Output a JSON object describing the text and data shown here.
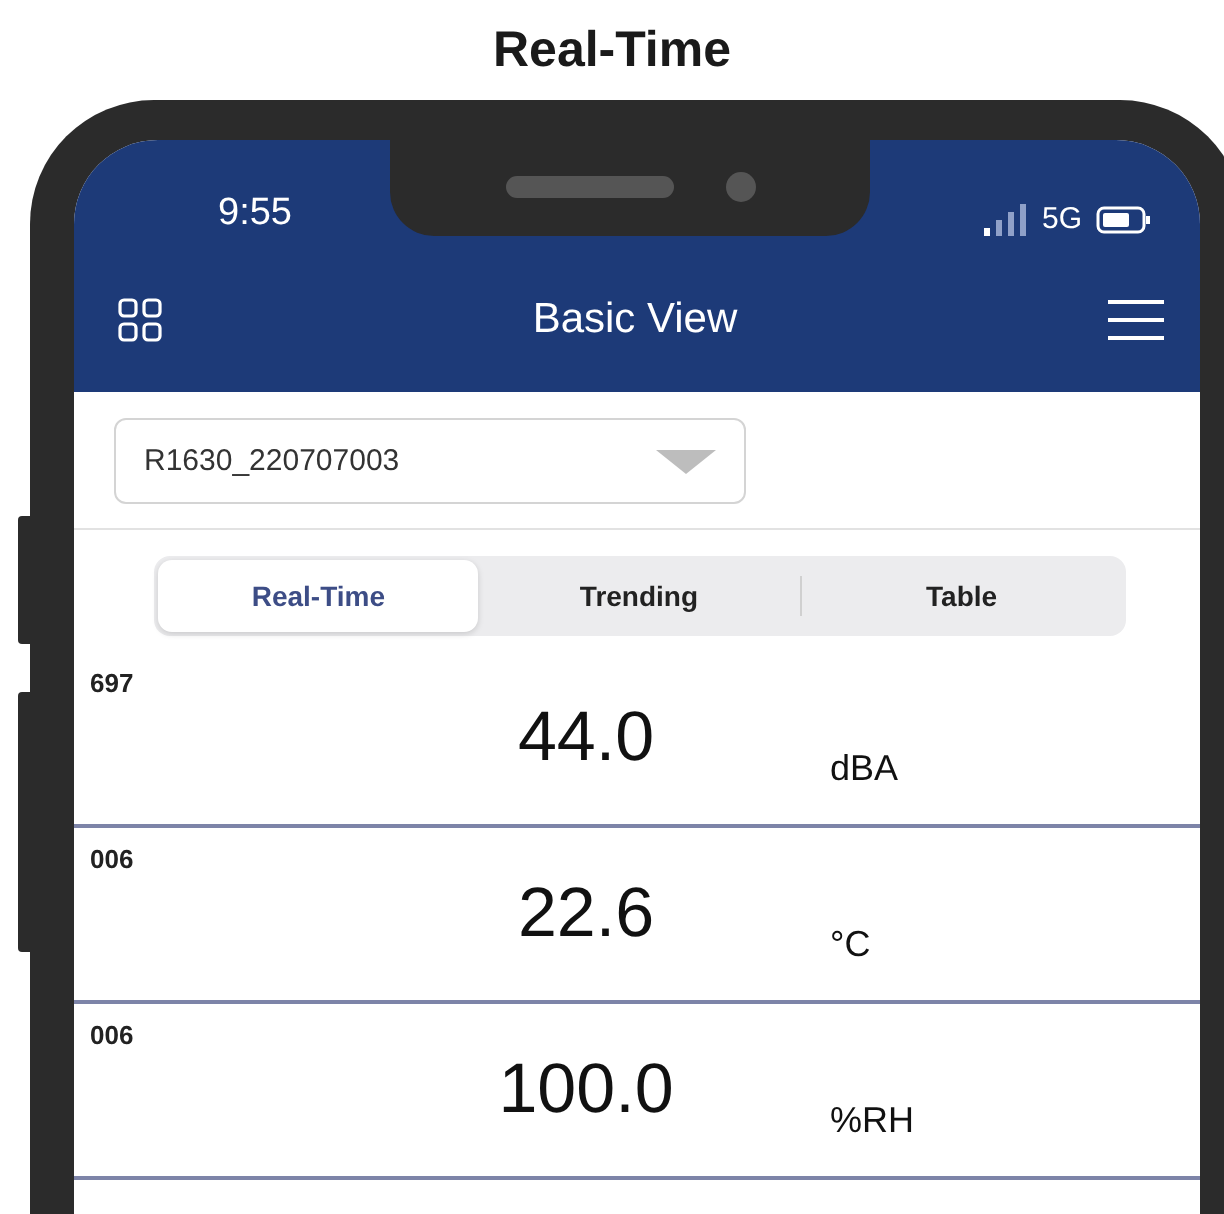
{
  "heading": "Real-Time",
  "status_bar": {
    "time": "9:55",
    "network": "5G"
  },
  "nav_bar": {
    "title": "Basic View"
  },
  "device_select": {
    "value": "R1630_220707003"
  },
  "tabs": [
    {
      "label": "Real-Time",
      "selected": true
    },
    {
      "label": "Trending",
      "selected": false
    },
    {
      "label": "Table",
      "selected": false
    }
  ],
  "readings": [
    {
      "channel": "697",
      "value": "44.0",
      "unit": "dBA"
    },
    {
      "channel": "006",
      "value": "22.6",
      "unit": "°C"
    },
    {
      "channel": "006",
      "value": "100.0",
      "unit": "%RH"
    }
  ]
}
